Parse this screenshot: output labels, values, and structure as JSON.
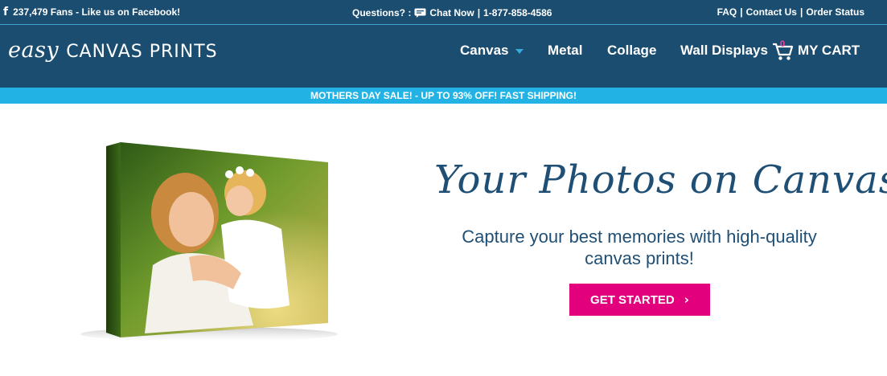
{
  "topbar": {
    "facebook_icon": "f",
    "facebook_text": "237,479 Fans - Like us on Facebook!",
    "questions": "Questions? :",
    "chat": "Chat Now",
    "separator": "|",
    "phone": "1-877-858-4586",
    "faq": "FAQ",
    "contact": "Contact Us",
    "order_status": "Order Status"
  },
  "logo": {
    "easy": "easy",
    "rest": "CANVAS PRINTS"
  },
  "nav": {
    "canvas": "Canvas",
    "metal": "Metal",
    "collage": "Collage",
    "wall_displays": "Wall Displays"
  },
  "cart": {
    "count": "0",
    "label": "MY CART"
  },
  "promo": "MOTHERS DAY SALE! - UP TO 93% OFF! FAST SHIPPING!",
  "hero": {
    "headline": "Your Photos on Canvas!",
    "subtext_line1": "Capture your best memories with high-quality",
    "subtext_line2": "canvas prints!",
    "cta": "GET STARTED",
    "cta_icon": "›"
  },
  "colors": {
    "header": "#1b4d70",
    "promo": "#22b3e4",
    "cta": "#e3007c",
    "text_dark": "#1f4f74"
  },
  "icons": [
    "facebook-icon",
    "chat-icon",
    "caret-down-icon",
    "cart-icon",
    "chevron-right-icon"
  ]
}
